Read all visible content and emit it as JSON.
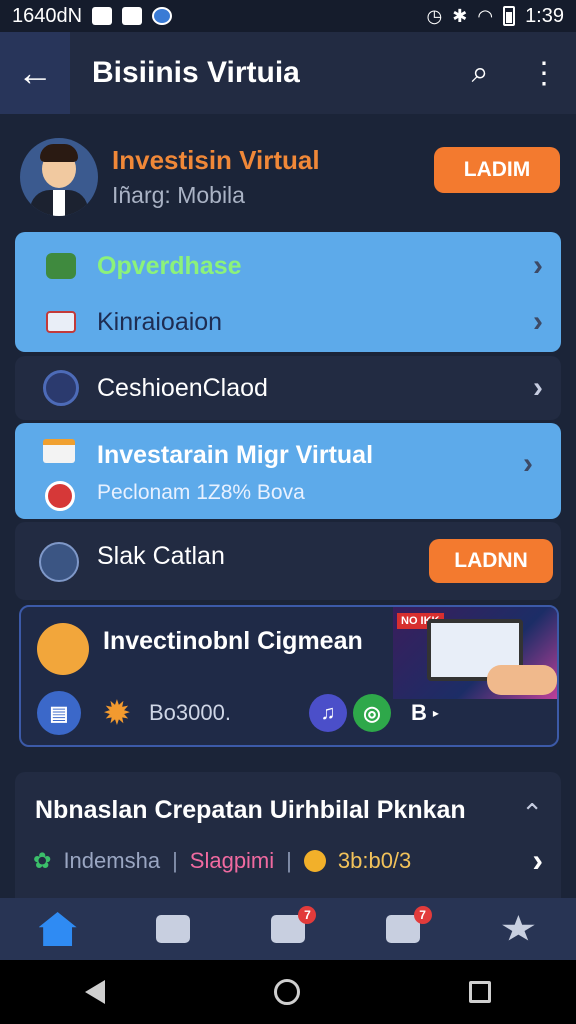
{
  "status_bar": {
    "left_text": "1640dN",
    "time": "1:39"
  },
  "app_bar": {
    "title": "Bisiinis Virtuia"
  },
  "profile": {
    "title": "Investisin Virtual",
    "subtitle": "Iñarg: Mobila",
    "button": "LADIM"
  },
  "blue_card_1": {
    "items": [
      {
        "label": "Opverdhase"
      },
      {
        "label": "Kinraioaion"
      }
    ]
  },
  "dark_row_1": {
    "label": "CeshioenClaod"
  },
  "blue_card_2": {
    "title": "Investarain Migr Virtual",
    "subtitle": "Peclonam 1Z8% Bova"
  },
  "dark_row_2": {
    "label": "Slak Catlan",
    "button": "LADNN"
  },
  "promo": {
    "title": "Invectinobnl Cigmean",
    "image_tag": "NO IKK",
    "amount": "Bo3000.",
    "extra_label": "B"
  },
  "section": {
    "title": "Nbnaslan Crepatan Uirhbilal Pknkan",
    "stats": [
      {
        "text": "Indemsha"
      },
      {
        "text": "Slagpimi"
      },
      {
        "text": "3b:b0/3"
      }
    ]
  },
  "bottom_nav": {
    "badge_1": "7",
    "badge_2": "7"
  },
  "colors": {
    "accent_orange": "#f37a2f",
    "card_blue": "#5daaea",
    "background": "#1b2438",
    "card_dark": "#222b42"
  }
}
